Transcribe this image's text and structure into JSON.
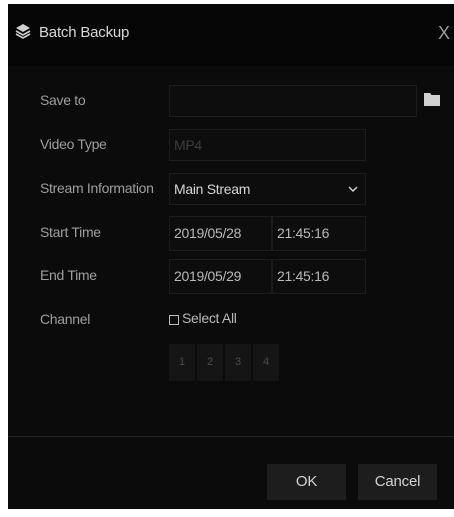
{
  "dialog": {
    "title": "Batch Backup",
    "title_icon": "layers-icon",
    "close_glyph": "X"
  },
  "form": {
    "save_to": {
      "label": "Save to",
      "value": "",
      "icon": "folder-icon"
    },
    "video_type": {
      "label": "Video Type",
      "value": "MP4"
    },
    "stream_information": {
      "label": "Stream Information",
      "selected": "Main Stream"
    },
    "start_time": {
      "label": "Start Time",
      "date": "2019/05/28",
      "time": "21:45:16"
    },
    "end_time": {
      "label": "End Time",
      "date": "2019/05/29",
      "time": "21:45:16"
    },
    "channel": {
      "label": "Channel",
      "select_all": "Select All",
      "select_all_checked": false,
      "channels": [
        "1",
        "2",
        "3",
        "4"
      ]
    }
  },
  "buttons": {
    "ok": "OK",
    "cancel": "Cancel"
  },
  "colors": {
    "dialog_bg": "#0b0b0b",
    "text": "#d7d7d7",
    "label": "#9f9f9f",
    "button_bg": "#1d1d1d"
  }
}
